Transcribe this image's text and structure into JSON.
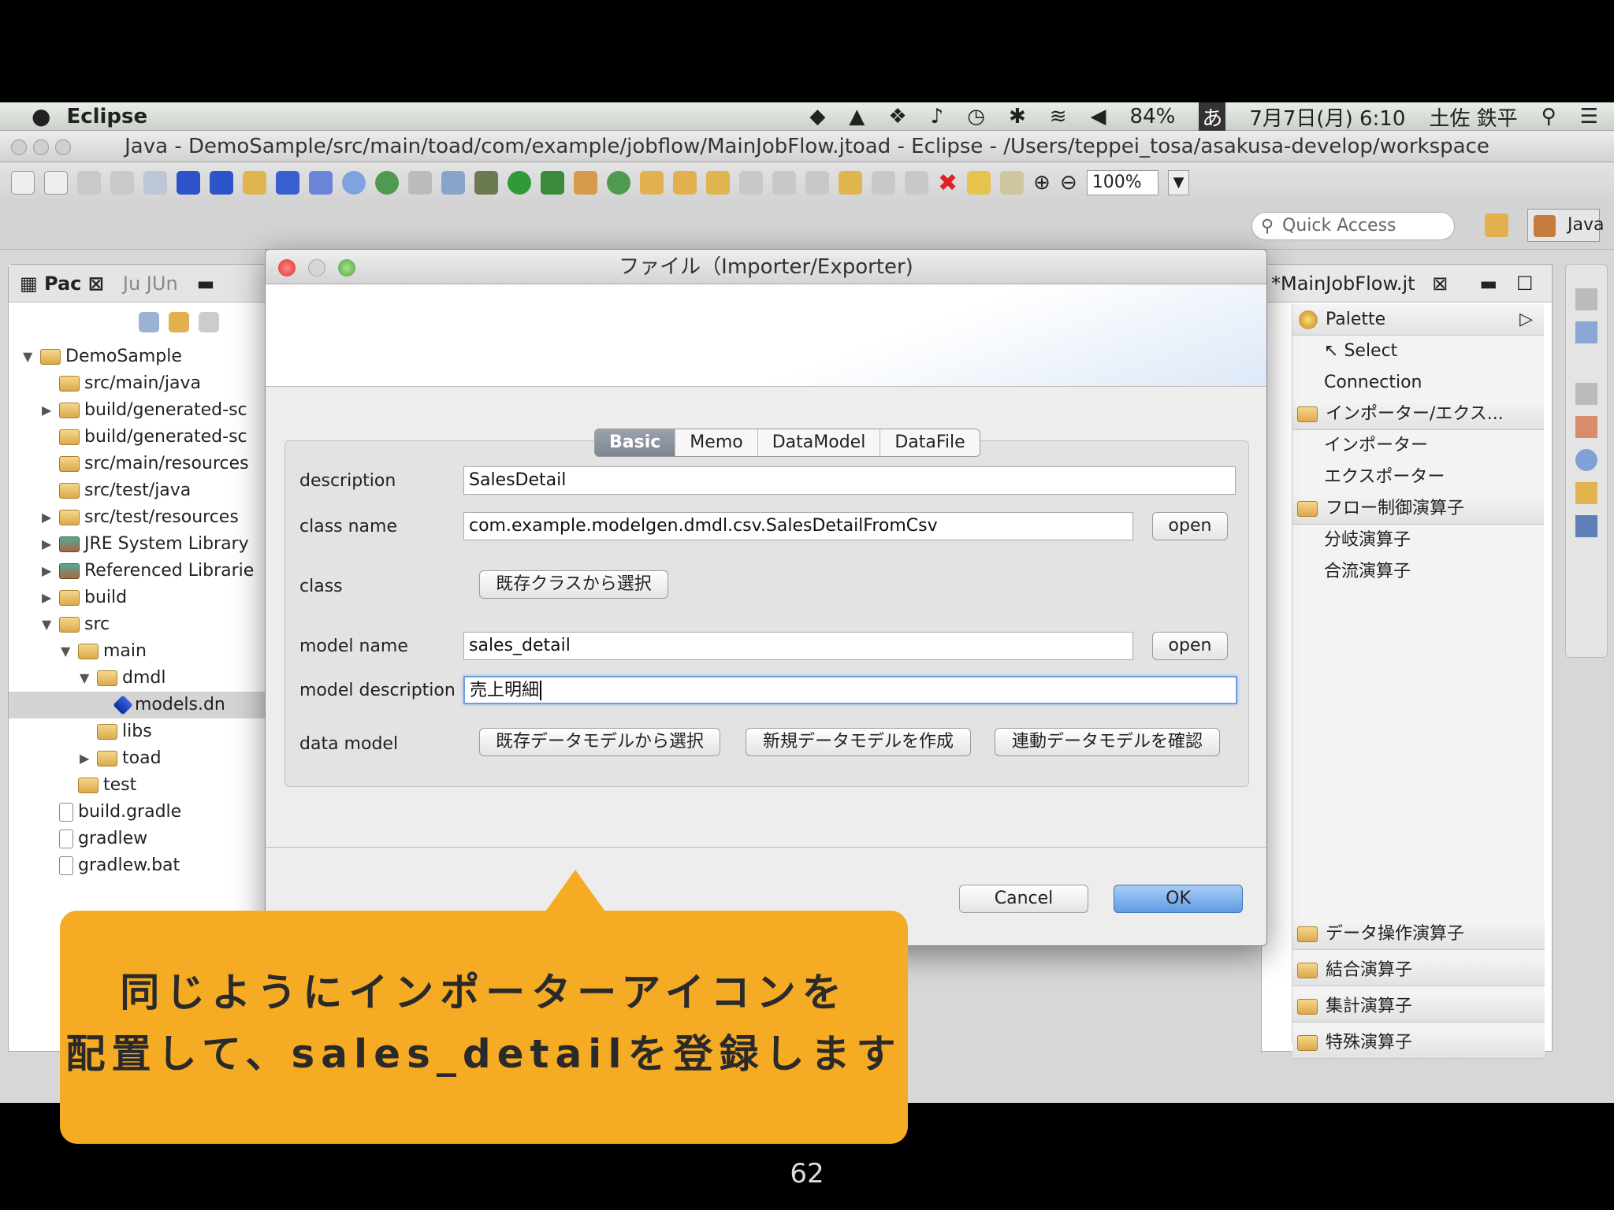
{
  "menubar": {
    "app": "Eclipse",
    "battery": "84%",
    "input_method": "あ",
    "datetime": "7月7日(月) 6:10",
    "user": "土佐 鉄平"
  },
  "window": {
    "title": "Java - DemoSample/src/main/toad/com/example/jobflow/MainJobFlow.jtoad - Eclipse - /Users/teppei_tosa/asakusa-develop/workspace"
  },
  "toolbar": {
    "zoom": "100%",
    "quick_access_placeholder": "Quick Access",
    "perspective": "Java"
  },
  "package_explorer": {
    "tab_pkg": "Pac",
    "tab_junit": "JUn",
    "tree": [
      {
        "label": "DemoSample",
        "indent": 0,
        "arrow": "▼",
        "icon": "project"
      },
      {
        "label": "src/main/java",
        "indent": 1,
        "arrow": "",
        "icon": "folder"
      },
      {
        "label": "build/generated-sc",
        "indent": 1,
        "arrow": "▶",
        "icon": "folder"
      },
      {
        "label": "build/generated-sc",
        "indent": 1,
        "arrow": "",
        "icon": "folder"
      },
      {
        "label": "src/main/resources",
        "indent": 1,
        "arrow": "",
        "icon": "folder"
      },
      {
        "label": "src/test/java",
        "indent": 1,
        "arrow": "",
        "icon": "folder"
      },
      {
        "label": "src/test/resources",
        "indent": 1,
        "arrow": "▶",
        "icon": "folder"
      },
      {
        "label": "JRE System Library",
        "indent": 1,
        "arrow": "▶",
        "icon": "jar"
      },
      {
        "label": "Referenced Librarie",
        "indent": 1,
        "arrow": "▶",
        "icon": "jar"
      },
      {
        "label": "build",
        "indent": 1,
        "arrow": "▶",
        "icon": "folder"
      },
      {
        "label": "src",
        "indent": 1,
        "arrow": "▼",
        "icon": "folder"
      },
      {
        "label": "main",
        "indent": 2,
        "arrow": "▼",
        "icon": "folder"
      },
      {
        "label": "dmdl",
        "indent": 3,
        "arrow": "▼",
        "icon": "folder"
      },
      {
        "label": "models.dn",
        "indent": 4,
        "arrow": "",
        "icon": "dmdl",
        "selected": true
      },
      {
        "label": "libs",
        "indent": 3,
        "arrow": "",
        "icon": "folder"
      },
      {
        "label": "toad",
        "indent": 3,
        "arrow": "▶",
        "icon": "folder"
      },
      {
        "label": "test",
        "indent": 2,
        "arrow": "",
        "icon": "folder"
      },
      {
        "label": "build.gradle",
        "indent": 1,
        "arrow": "",
        "icon": "file"
      },
      {
        "label": "gradlew",
        "indent": 1,
        "arrow": "",
        "icon": "file"
      },
      {
        "label": "gradlew.bat",
        "indent": 1,
        "arrow": "",
        "icon": "file"
      }
    ]
  },
  "editor": {
    "tab": "*MainJobFlow.jt",
    "palette": {
      "title": "Palette",
      "select": "Select",
      "connection": "Connection",
      "drawer1": "インポーター/エクス...",
      "drawer1_items": [
        "インポーター",
        "エクスポーター"
      ],
      "drawer2": "フロー制御演算子",
      "drawer2_items": [
        "分岐演算子",
        "合流演算子"
      ],
      "bottom_drawers": [
        "データ操作演算子",
        "結合演算子",
        "集計演算子",
        "特殊演算子"
      ]
    }
  },
  "dialog": {
    "title": "ファイル（Importer/Exporter)",
    "tabs": [
      "Basic",
      "Memo",
      "DataModel",
      "DataFile"
    ],
    "active_tab": "Basic",
    "labels": {
      "description": "description",
      "class_name": "class name",
      "class": "class",
      "model_name": "model name",
      "model_description": "model description",
      "data_model": "data model"
    },
    "values": {
      "description": "SalesDetail",
      "class_name": "com.example.modelgen.dmdl.csv.SalesDetailFromCsv",
      "model_name": "sales_detail",
      "model_description": "売上明細"
    },
    "buttons": {
      "open1": "open",
      "open2": "open",
      "select_class": "既存クラスから選択",
      "select_model": "既存データモデルから選択",
      "new_model": "新規データモデルを作成",
      "check_model": "連動データモデルを確認",
      "cancel": "Cancel",
      "ok": "OK"
    }
  },
  "callout": {
    "line1": "同じようにインポーターアイコンを",
    "line2": "配置して、sales_detailを登録します"
  },
  "page_number": "62"
}
